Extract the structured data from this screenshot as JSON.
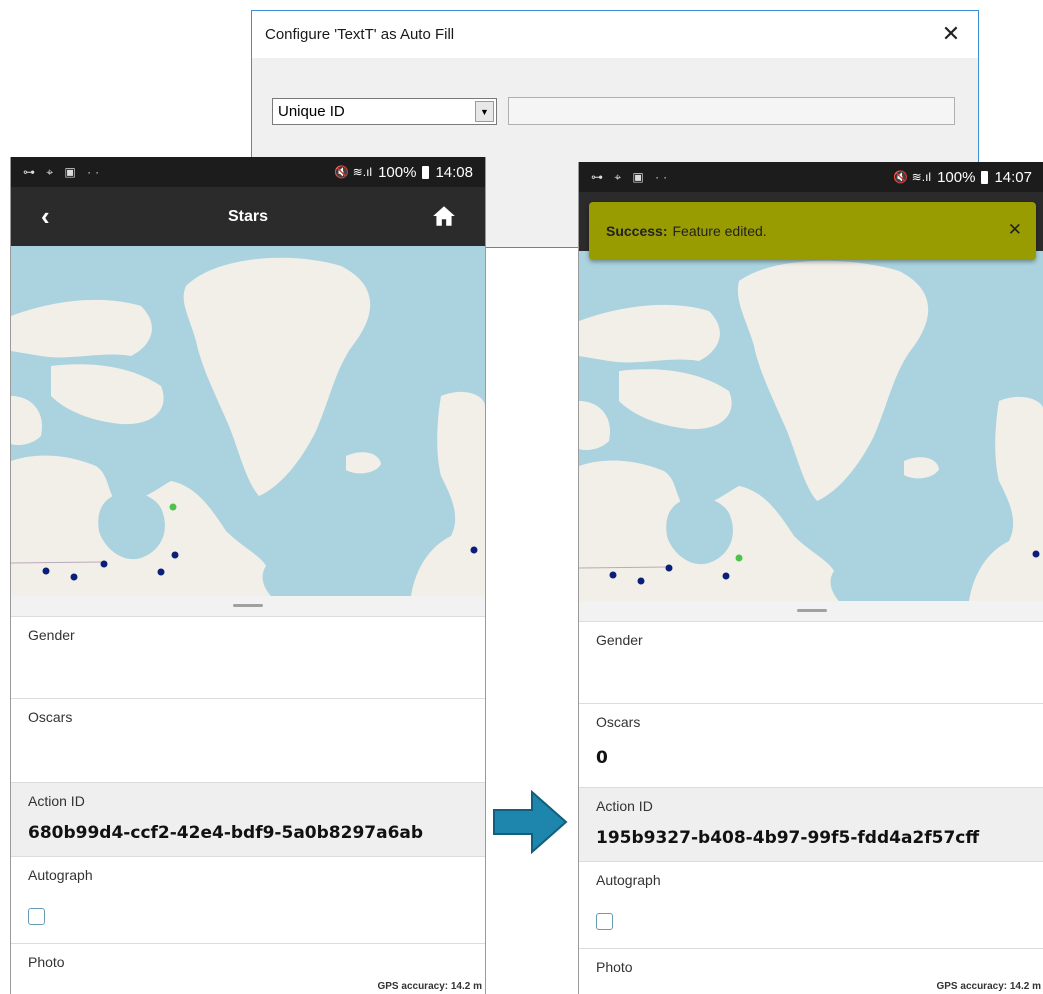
{
  "dialog": {
    "title": "Configure 'TextT' as Auto Fill",
    "close_glyph": "✕",
    "select_value": "Unique ID",
    "dropdown_glyph": "▼",
    "text_value": ""
  },
  "phone_left": {
    "status": {
      "time": "14:08",
      "battery": "100%",
      "left_icons": "⊶ ⌖ ▣ ··",
      "signal_icons": "🔇 ≋.ıl"
    },
    "appbar": {
      "title": "Stars",
      "back_glyph": "‹"
    },
    "fields": [
      {
        "label": "Gender",
        "value": ""
      },
      {
        "label": "Oscars",
        "value": ""
      },
      {
        "label": "Action ID",
        "value": "680b99d4-ccf2-42e4-bdf9-5a0b8297a6ab"
      },
      {
        "label": "Autograph"
      },
      {
        "label": "Photo"
      }
    ],
    "gps": "GPS accuracy: 14.2 m"
  },
  "phone_right": {
    "status": {
      "time": "14:07",
      "battery": "100%",
      "left_icons": "⊶ ⌖ ▣ ··",
      "signal_icons": "🔇 ≋.ıl"
    },
    "toast": {
      "label": "Success:",
      "message": "Feature edited.",
      "close_glyph": "✕"
    },
    "fields": [
      {
        "label": "Gender",
        "value": ""
      },
      {
        "label": "Oscars",
        "value": "0"
      },
      {
        "label": "Action ID",
        "value": "195b9327-b408-4b97-99f5-fdd4a2f57cff"
      },
      {
        "label": "Autograph"
      },
      {
        "label": "Photo"
      }
    ],
    "gps": "GPS accuracy: 14.2 m"
  },
  "colors": {
    "map_water": "#aad3df",
    "map_land": "#f2efe9",
    "point_dark": "#0b1f7a",
    "point_green": "#4cc44c",
    "toast_bg": "#999c00",
    "arrow": "#1e86ad"
  },
  "icons": [
    "close-icon",
    "dropdown-arrow-icon",
    "back-icon",
    "home-icon",
    "battery-icon",
    "wifi-icon",
    "mute-icon",
    "key-icon",
    "arrow-right-icon"
  ]
}
